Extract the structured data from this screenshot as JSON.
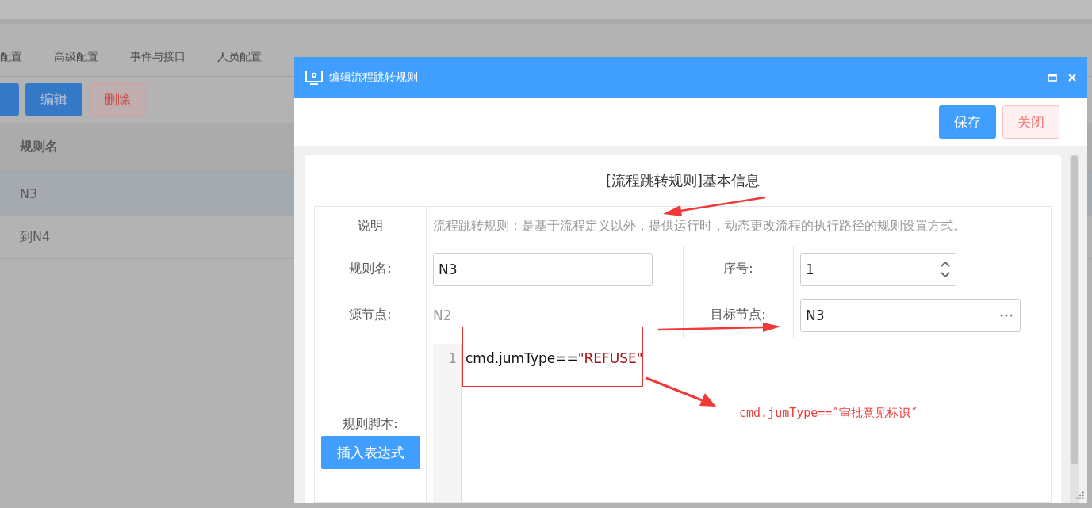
{
  "background": {
    "tabs": [
      "配置",
      "高级配置",
      "事件与接口",
      "人员配置"
    ],
    "toolbar": [
      {
        "kind": "primary"
      },
      {
        "label": "编辑",
        "kind": "primary"
      },
      {
        "label": "删除",
        "kind": "danger"
      }
    ],
    "table": {
      "columns": [
        "规则名"
      ],
      "rows": [
        {
          "name": "N3",
          "selected": true
        },
        {
          "name": "到N4",
          "selected": false
        }
      ]
    }
  },
  "dialog": {
    "title": "编辑流程跳转规则",
    "buttons": [
      {
        "label": "保存",
        "kind": "primary"
      },
      {
        "label": "关闭",
        "kind": "danger"
      }
    ],
    "form": {
      "heading": "[流程跳转规则]基本信息",
      "description_label": "说明",
      "description": "流程跳转规则：是基于流程定义以外，提供运行时，动态更改流程的执行路径的规则设置方式。",
      "rule_name_label": "规则名:",
      "rule_name": "N3",
      "order_label": "序号:",
      "order": "1",
      "source_label": "源节点:",
      "source": "N2",
      "target_label": "目标节点:",
      "target": "N3",
      "script_label": "规则脚本:",
      "insert_button": "插入表达式",
      "code_lines": [
        {
          "number": "1",
          "tokens": [
            {
              "text": "cmd.jumType==",
              "kind": "plain"
            },
            {
              "text": "\"REFUSE\"",
              "kind": "string"
            }
          ]
        }
      ]
    }
  },
  "annotation": {
    "text": "cmd.jumType==″审批意见标识″"
  }
}
